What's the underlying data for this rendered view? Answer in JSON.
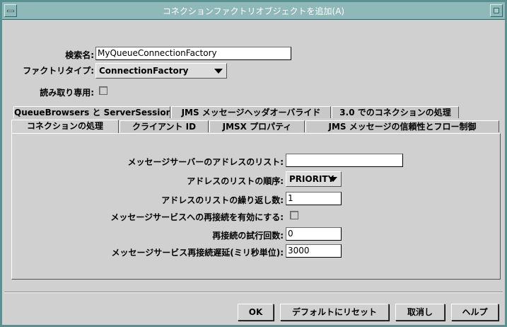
{
  "window": {
    "title": "コネクションファクトリオブジェクトを追加(A)"
  },
  "form": {
    "name_label": "検索名:",
    "name_value": "MyQueueConnectionFactory",
    "factory_type_label": "ファクトリタイプ:",
    "factory_type_value": "ConnectionFactory",
    "readonly_label": "読み取り専用:",
    "readonly_checked": false
  },
  "tabs": {
    "row1": [
      "QueueBrowsers と ServerSessions",
      "JMS メッセージヘッダオーバライド",
      "3.0 でのコネクションの処理"
    ],
    "row2": [
      "コネクションの処理",
      "クライアント ID",
      "JMSX プロパティ",
      "JMS メッセージの信頼性とフロー制御"
    ],
    "active": "コネクションの処理"
  },
  "panel": {
    "broker_list_label": "メッセージサーバーのアドレスのリスト:",
    "broker_list_value": "",
    "order_label": "アドレスのリストの順序:",
    "order_value": "PRIORITY",
    "repeat_label": "アドレスのリストの繰り返し数:",
    "repeat_value": "1",
    "reconnect_label": "メッセージサービスへの再接続を有効にする:",
    "reconnect_checked": false,
    "attempts_label": "再接続の試行回数:",
    "attempts_value": "0",
    "delay_label": "メッセージサービス再接続遅延(ミリ秒単位):",
    "delay_value": "3000"
  },
  "buttons": {
    "ok": "OK",
    "reset": "デフォルトにリセット",
    "cancel": "取消し",
    "help": "ヘルプ"
  }
}
